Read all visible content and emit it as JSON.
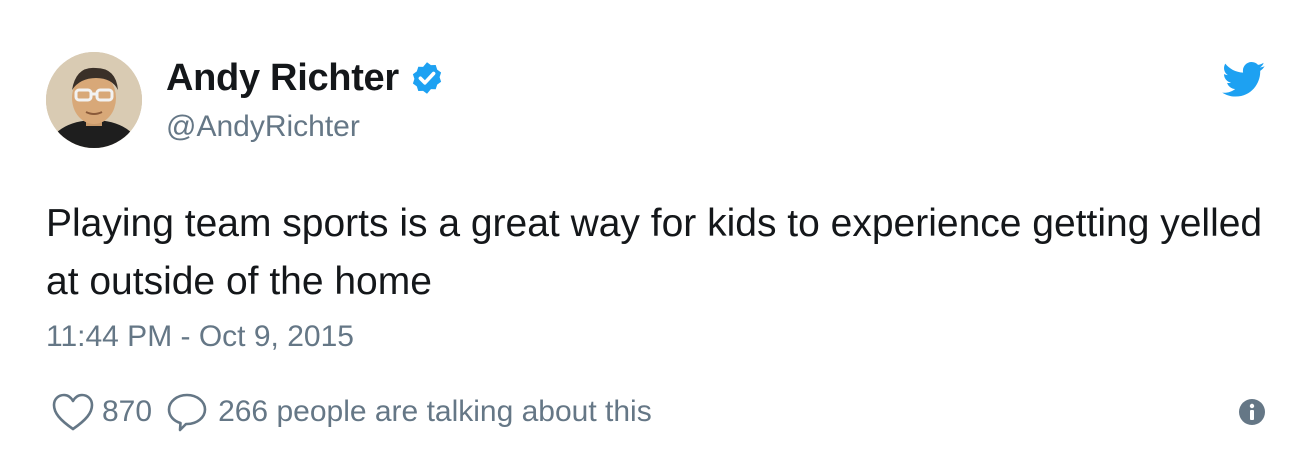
{
  "author": {
    "display_name": "Andy Richter",
    "handle": "@AndyRichter",
    "verified": true
  },
  "tweet": {
    "text": "Playing team sports is a great way for kids to experience getting yelled at outside of the home",
    "timestamp": "11:44 PM - Oct 9, 2015"
  },
  "stats": {
    "likes": "870",
    "talking": "266 people are talking about this"
  },
  "icons": {
    "verified": "verified-badge-icon",
    "brand": "twitter-bird-icon",
    "like": "heart-icon",
    "reply": "speech-bubble-icon",
    "info": "info-icon"
  },
  "colors": {
    "brand_blue": "#1da1f2",
    "text": "#14171a",
    "muted": "#657786"
  }
}
